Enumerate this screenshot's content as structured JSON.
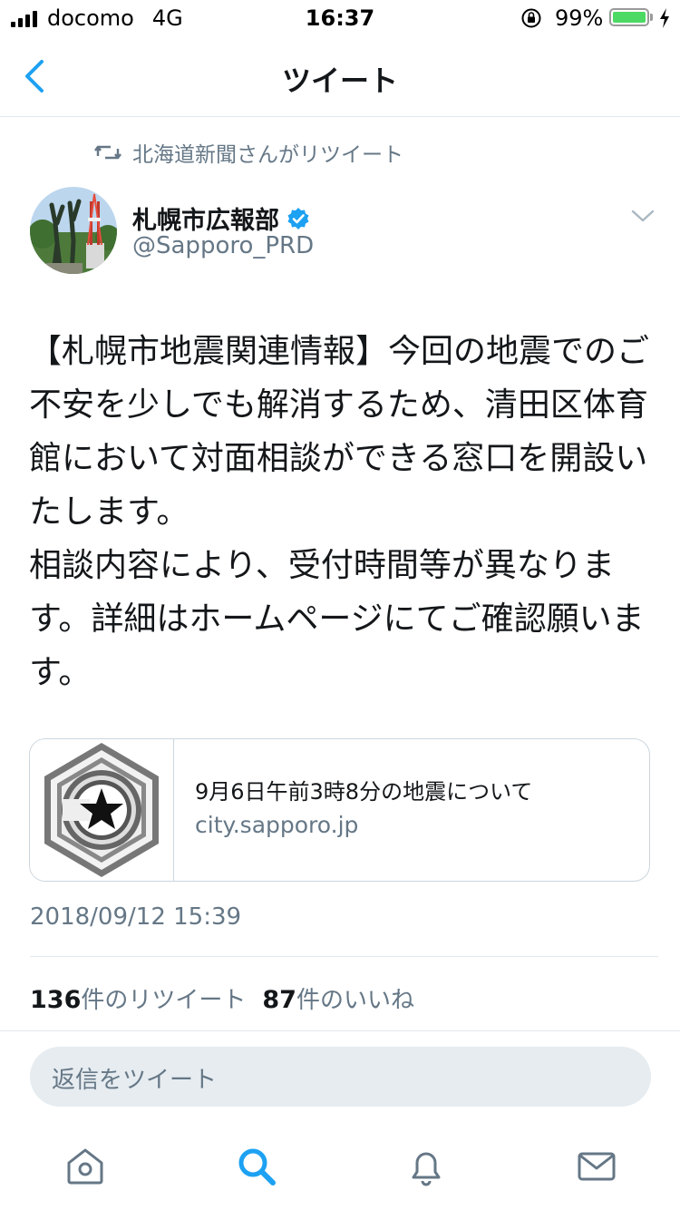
{
  "status_bar": {
    "carrier": "docomo",
    "network": "4G",
    "time": "16:37",
    "battery_percent": "99%",
    "battery_level": 0.99
  },
  "nav": {
    "title": "ツイート",
    "back_icon": "chevron-left-icon"
  },
  "retweet_context": {
    "text": "北海道新聞さんがリツイート",
    "icon": "retweet-icon"
  },
  "author": {
    "display_name": "札幌市広報部",
    "handle": "@Sapporo_PRD",
    "verified": true
  },
  "tweet": {
    "text": "【札幌市地震関連情報】今回の地震でのご不安を少しでも解消するため、清田区体育館において対面相談ができる窓口を開設いたします。\n相談内容により、受付時間等が異なります。詳細はホームページにてご確認願います。",
    "timestamp": "2018/09/12 15:39"
  },
  "link_card": {
    "title": "9月6日午前3時8分の地震について",
    "domain": "city.sapporo.jp"
  },
  "stats": {
    "retweets_count": "136",
    "retweets_label": "件のリツイート",
    "likes_count": "87",
    "likes_label": "件のいいね"
  },
  "reply": {
    "placeholder": "返信をツイート"
  },
  "tab_bar": {
    "items": [
      "home-icon",
      "search-icon",
      "notifications-icon",
      "messages-icon"
    ],
    "active": "search-icon"
  },
  "colors": {
    "accent": "#1da1f2",
    "secondary_text": "#657786",
    "battery": "#4cd964"
  }
}
